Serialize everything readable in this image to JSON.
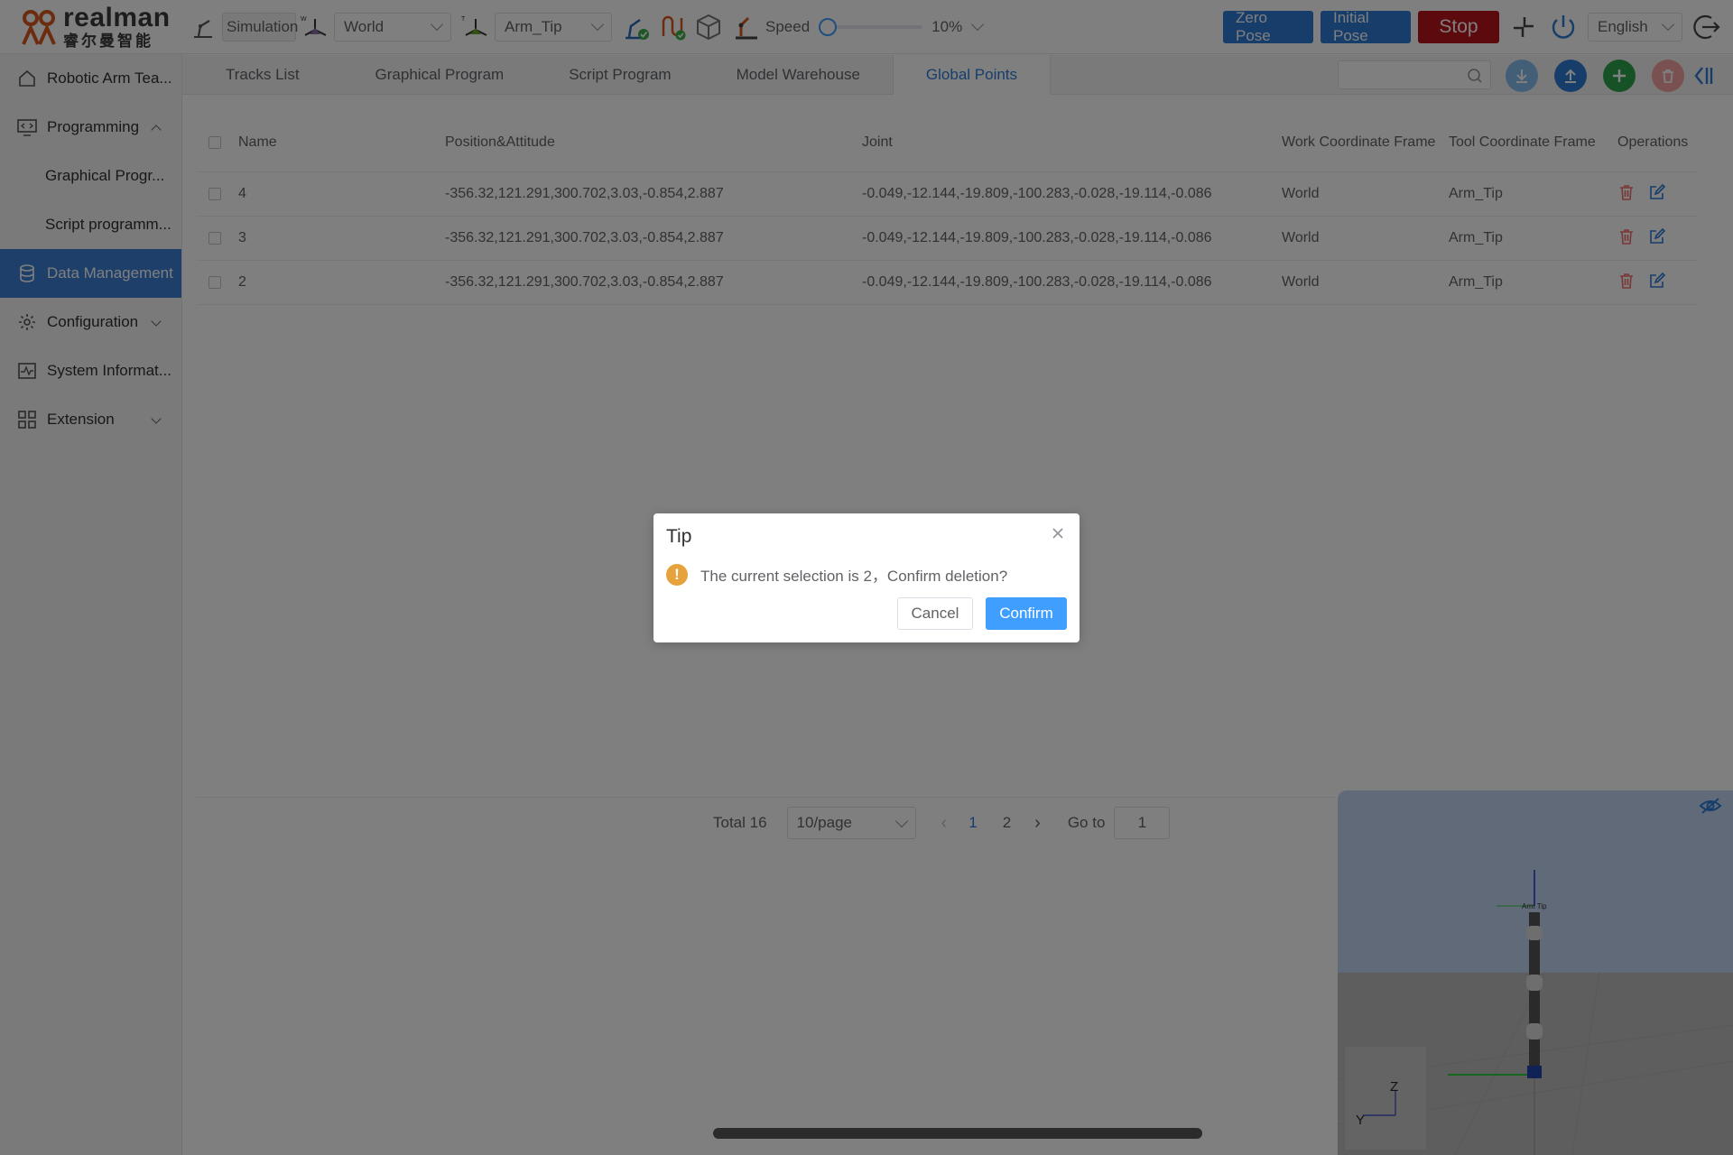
{
  "brand": {
    "name_en": "realman",
    "name_cn": "睿尔曼智能"
  },
  "toolbar": {
    "mode_label": "Simulation",
    "coord_select": "World",
    "tool_select": "Arm_Tip",
    "speed_label": "Speed",
    "speed_value": "10%",
    "speed_fraction": 0.0,
    "zero_pose": "Zero Pose",
    "initial_pose": "Initial Pose",
    "stop": "Stop",
    "language": "English"
  },
  "sidebar": {
    "items": [
      {
        "label": "Robotic Arm Tea...",
        "icon": "home-icon"
      },
      {
        "label": "Programming",
        "icon": "programming-icon",
        "expanded": true
      },
      {
        "label": "Graphical Progr...",
        "sub": true
      },
      {
        "label": "Script programm...",
        "sub": true
      },
      {
        "label": "Data Management",
        "icon": "database-icon",
        "active": true
      },
      {
        "label": "Configuration",
        "icon": "gear-icon"
      },
      {
        "label": "System Informat...",
        "icon": "monitor-icon"
      },
      {
        "label": "Extension",
        "icon": "grid-icon"
      }
    ]
  },
  "tabs": [
    "Tracks List",
    "Graphical Program",
    "Script Program",
    "Model Warehouse",
    "Global Points"
  ],
  "active_tab": "Global Points",
  "table": {
    "headers": {
      "name": "Name",
      "pose": "Position&Attitude",
      "joint": "Joint",
      "work_frame": "Work Coordinate Frame",
      "tool_frame": "Tool Coordinate Frame",
      "ops": "Operations"
    },
    "rows": [
      {
        "name": "4",
        "pose": "-356.32,121.291,300.702,3.03,-0.854,2.887",
        "joint": "-0.049,-12.144,-19.809,-100.283,-0.028,-19.114,-0.086",
        "work": "World",
        "tool": "Arm_Tip"
      },
      {
        "name": "3",
        "pose": "-356.32,121.291,300.702,3.03,-0.854,2.887",
        "joint": "-0.049,-12.144,-19.809,-100.283,-0.028,-19.114,-0.086",
        "work": "World",
        "tool": "Arm_Tip"
      },
      {
        "name": "2",
        "pose": "-356.32,121.291,300.702,3.03,-0.854,2.887",
        "joint": "-0.049,-12.144,-19.809,-100.283,-0.028,-19.114,-0.086",
        "work": "World",
        "tool": "Arm_Tip"
      }
    ]
  },
  "pagination": {
    "total": "Total 16",
    "page_size": "10/page",
    "pages": [
      "1",
      "2"
    ],
    "current": "1",
    "goto_label": "Go to",
    "goto_value": "1"
  },
  "dialog": {
    "title": "Tip",
    "message": "The current selection is 2，Confirm deletion?",
    "cancel": "Cancel",
    "confirm": "Confirm"
  },
  "viewer": {
    "axis_z": "Z",
    "axis_y": "Y",
    "tool_label": "Arm Tip"
  },
  "colors": {
    "primary": "#409eff",
    "active_nav": "#3a7fd5",
    "stop": "#b8141b",
    "warning": "#e6a23c",
    "delete": "#f56c6c",
    "add": "#2ea44f"
  }
}
